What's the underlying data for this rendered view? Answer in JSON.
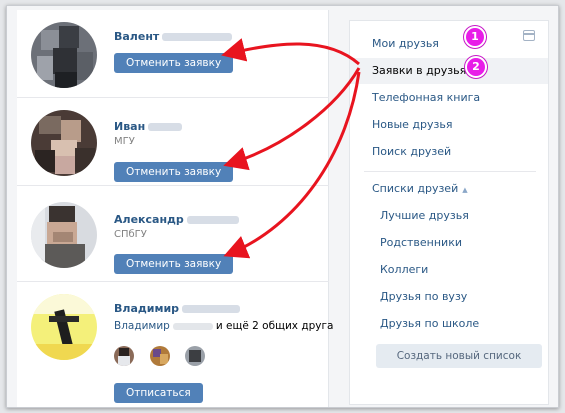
{
  "friends": [
    {
      "name": "Валент",
      "sub": "",
      "button": "Отменить заявку"
    },
    {
      "name": "Иван",
      "sub": "МГУ",
      "button": "Отменить заявку"
    },
    {
      "name": "Александр",
      "sub": "СПбГУ",
      "button": "Отменить заявку"
    },
    {
      "name": "Владимир",
      "sub_prefix": "Владимир",
      "sub_rest": "и ещё 2 общих друга",
      "button": "Отписаться"
    }
  ],
  "sidebar": {
    "items": [
      {
        "label": "Мои друзья"
      },
      {
        "label": "Заявки в друзья"
      },
      {
        "label": "Телефонная книга"
      },
      {
        "label": "Новые друзья"
      },
      {
        "label": "Поиск друзей"
      }
    ],
    "lists_header": "Списки друзей",
    "lists": [
      {
        "label": "Лучшие друзья"
      },
      {
        "label": "Родственники"
      },
      {
        "label": "Коллеги"
      },
      {
        "label": "Друзья по вузу"
      },
      {
        "label": "Друзья по школе"
      }
    ],
    "create_button": "Создать новый список"
  },
  "annotations": {
    "badge1": "1",
    "badge2": "2"
  },
  "colors": {
    "link": "#2a5885",
    "button": "#5181b8",
    "arrow": "#e8141f",
    "badge": "#e81ce8"
  }
}
